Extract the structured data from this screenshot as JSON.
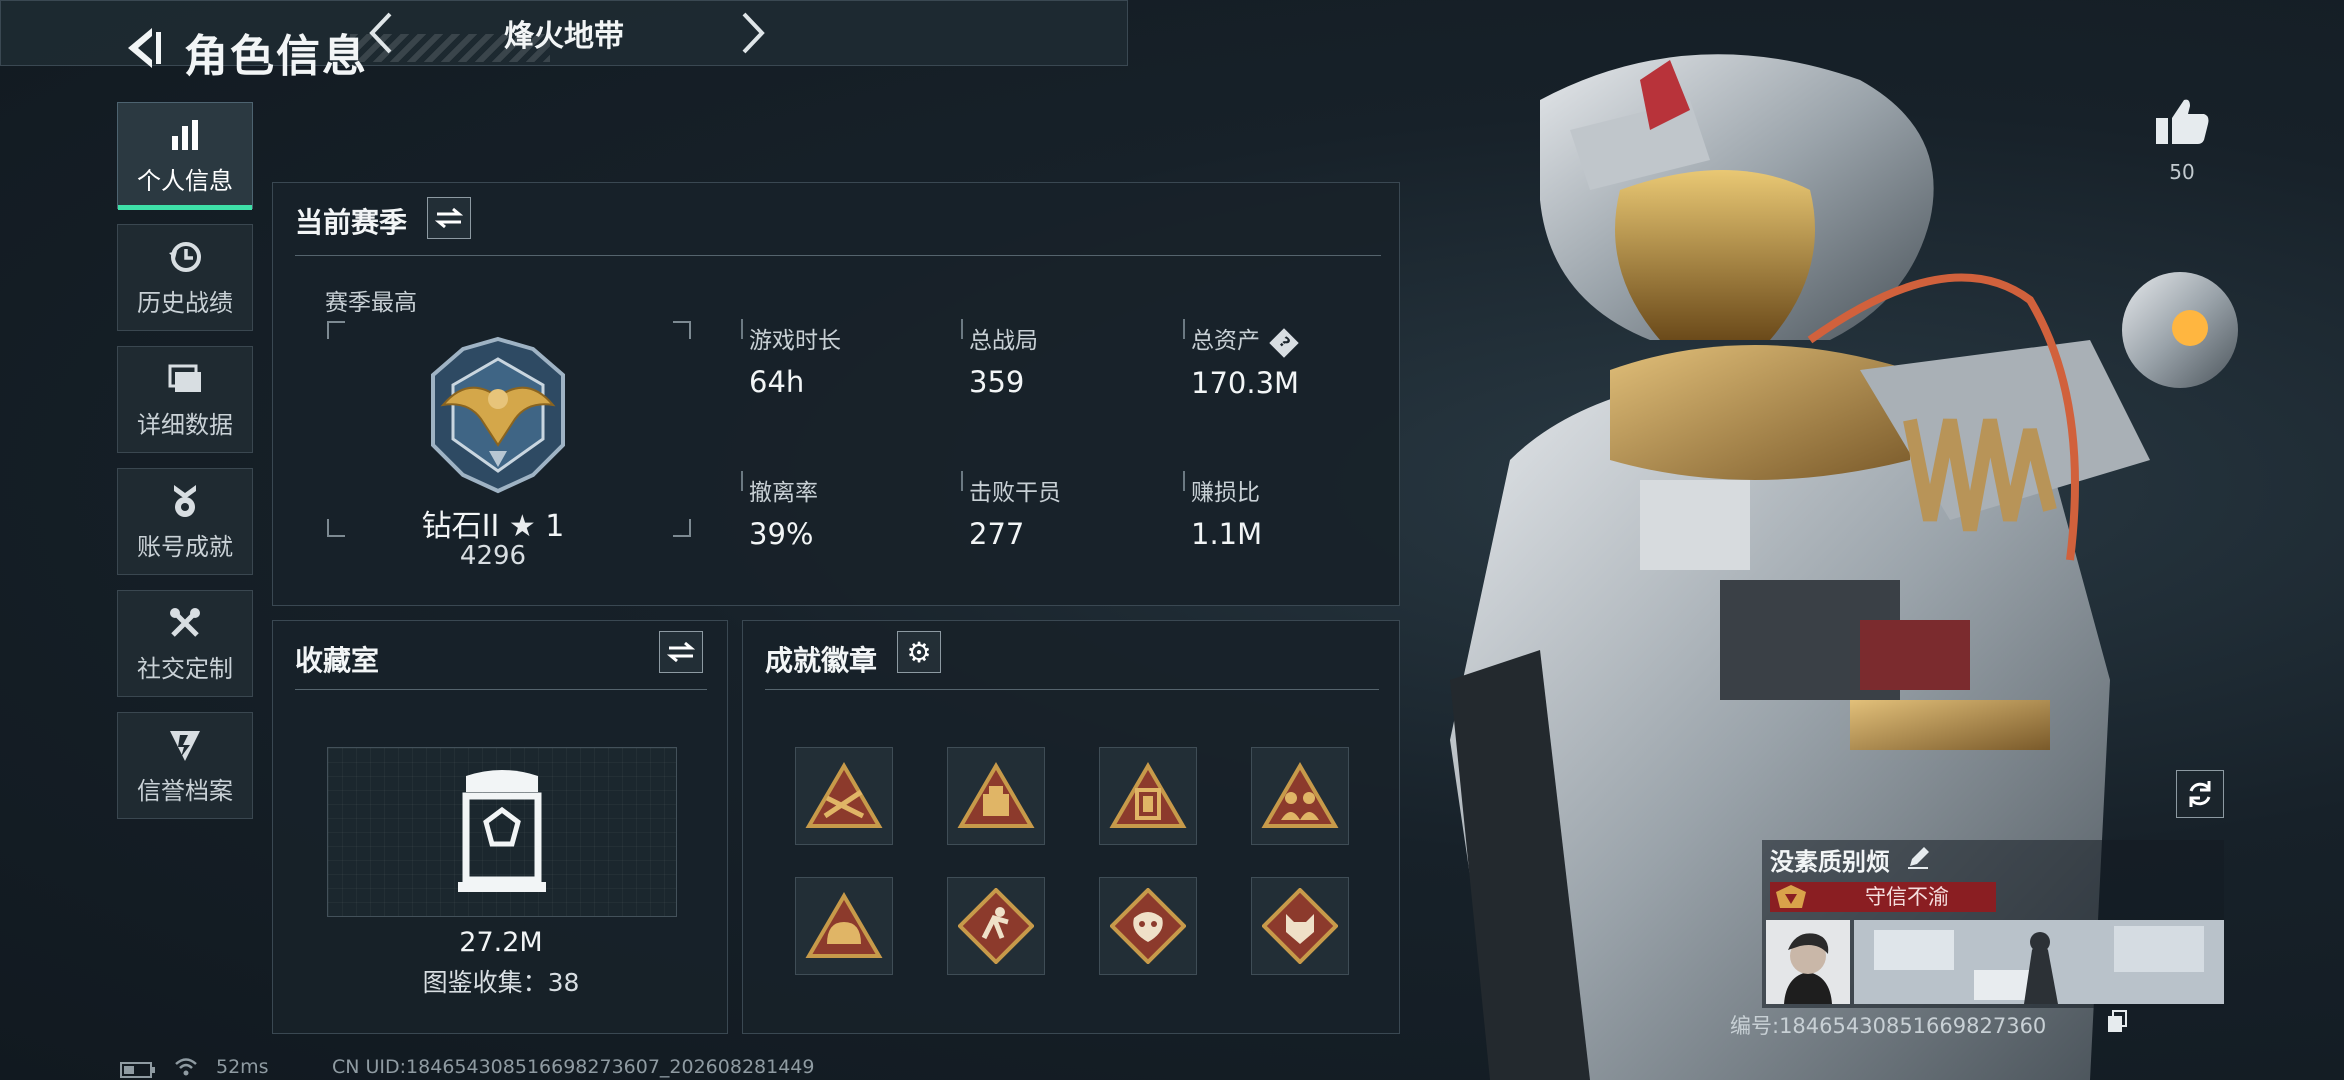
{
  "header": {
    "title": "角色信息"
  },
  "nav": {
    "items": [
      {
        "label": "个人信息",
        "icon": "bar-chart-icon",
        "active": true
      },
      {
        "label": "历史战绩",
        "icon": "history-clock-icon",
        "active": false
      },
      {
        "label": "详细数据",
        "icon": "folder-data-icon",
        "active": false
      },
      {
        "label": "账号成就",
        "icon": "achievement-medal-icon",
        "active": false
      },
      {
        "label": "社交定制",
        "icon": "tools-customize-icon",
        "active": false
      },
      {
        "label": "信誉档案",
        "icon": "reputation-shield-icon",
        "active": false
      }
    ]
  },
  "mode": {
    "title": "烽火地带"
  },
  "season": {
    "title": "当前赛季",
    "best_label": "赛季最高",
    "rank_name": "钻石II",
    "rank_stars": "1",
    "rank_points": "4296",
    "stats": [
      {
        "label": "游戏时长",
        "value": "64h"
      },
      {
        "label": "总战局",
        "value": "359"
      },
      {
        "label": "总资产",
        "value": "170.3M",
        "help": "?"
      },
      {
        "label": "撤离率",
        "value": "39%"
      },
      {
        "label": "击败干员",
        "value": "277"
      },
      {
        "label": "赚损比",
        "value": "1.1M"
      }
    ]
  },
  "collection": {
    "title": "收藏室",
    "value": "27.2M",
    "count_text": "图鉴收集：38"
  },
  "achievements": {
    "title": "成就徽章",
    "badges": [
      "badge-triangle-weapons-icon",
      "badge-triangle-crate-icon",
      "badge-triangle-lantern-icon",
      "badge-triangle-team-icon",
      "badge-triangle-helmet-icon",
      "badge-diamond-runner-icon",
      "badge-diamond-dragon-icon",
      "badge-diamond-beast-icon"
    ]
  },
  "player": {
    "like_count": "50",
    "name": "没素质别烦",
    "reputation": "守信不渝",
    "id_text": "编号:18465430851669827360"
  },
  "status": {
    "ping": "52ms",
    "uid": "CN UID:18465430851669827360​7_202608281449"
  },
  "colors": {
    "accent_green": "#3ee0a8",
    "reputation_red": "#8a1e22",
    "badge_gold": "#c79a4a",
    "badge_red": "#8c3a2c"
  }
}
